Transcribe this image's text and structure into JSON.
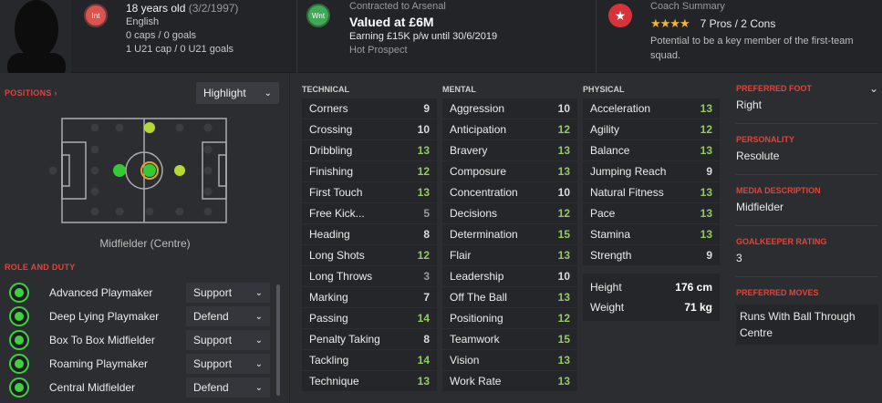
{
  "header": {
    "age": "18 years old",
    "dob": "(3/2/1997)",
    "nationality": "English",
    "caps": "0 caps / 0 goals",
    "u21": "1 U21 cap / 0 U21 goals",
    "badge_int": "Int",
    "contract_label": "Contracted to Arsenal",
    "value": "Valued at £6M",
    "earning": "Earning £15K p/w until 30/6/2019",
    "status": "Hot Prospect",
    "badge_wnt": "Wnt",
    "coach_title": "Coach Summary",
    "stars": "★★★★",
    "pros_cons": "7 Pros / 2 Cons",
    "potential": "Potential to be a key member of the first-team squad."
  },
  "positions": {
    "title": "POSITIONS",
    "filter": "Highlight",
    "position_name": "Midfielder (Centre)"
  },
  "roles": {
    "title": "ROLE AND DUTY",
    "items": [
      {
        "name": "Advanced Playmaker",
        "duty": "Support"
      },
      {
        "name": "Deep Lying Playmaker",
        "duty": "Defend"
      },
      {
        "name": "Box To Box Midfielder",
        "duty": "Support"
      },
      {
        "name": "Roaming Playmaker",
        "duty": "Support"
      },
      {
        "name": "Central Midfielder",
        "duty": "Defend"
      }
    ]
  },
  "technical": {
    "title": "TECHNICAL",
    "rows": [
      {
        "name": "Corners",
        "value": "9"
      },
      {
        "name": "Crossing",
        "value": "10"
      },
      {
        "name": "Dribbling",
        "value": "13"
      },
      {
        "name": "Finishing",
        "value": "12"
      },
      {
        "name": "First Touch",
        "value": "13"
      },
      {
        "name": "Free Kick...",
        "value": "5"
      },
      {
        "name": "Heading",
        "value": "8"
      },
      {
        "name": "Long Shots",
        "value": "12"
      },
      {
        "name": "Long Throws",
        "value": "3"
      },
      {
        "name": "Marking",
        "value": "7"
      },
      {
        "name": "Passing",
        "value": "14"
      },
      {
        "name": "Penalty Taking",
        "value": "8"
      },
      {
        "name": "Tackling",
        "value": "14"
      },
      {
        "name": "Technique",
        "value": "13"
      }
    ]
  },
  "mental": {
    "title": "MENTAL",
    "rows": [
      {
        "name": "Aggression",
        "value": "10"
      },
      {
        "name": "Anticipation",
        "value": "12"
      },
      {
        "name": "Bravery",
        "value": "13"
      },
      {
        "name": "Composure",
        "value": "13"
      },
      {
        "name": "Concentration",
        "value": "10"
      },
      {
        "name": "Decisions",
        "value": "12"
      },
      {
        "name": "Determination",
        "value": "15"
      },
      {
        "name": "Flair",
        "value": "13"
      },
      {
        "name": "Leadership",
        "value": "10"
      },
      {
        "name": "Off The Ball",
        "value": "13"
      },
      {
        "name": "Positioning",
        "value": "12"
      },
      {
        "name": "Teamwork",
        "value": "15"
      },
      {
        "name": "Vision",
        "value": "13"
      },
      {
        "name": "Work Rate",
        "value": "13"
      }
    ]
  },
  "physical": {
    "title": "PHYSICAL",
    "rows": [
      {
        "name": "Acceleration",
        "value": "13"
      },
      {
        "name": "Agility",
        "value": "12"
      },
      {
        "name": "Balance",
        "value": "13"
      },
      {
        "name": "Jumping Reach",
        "value": "9"
      },
      {
        "name": "Natural Fitness",
        "value": "13"
      },
      {
        "name": "Pace",
        "value": "13"
      },
      {
        "name": "Stamina",
        "value": "13"
      },
      {
        "name": "Strength",
        "value": "9"
      }
    ],
    "height_label": "Height",
    "height": "176 cm",
    "weight_label": "Weight",
    "weight": "71 kg"
  },
  "info": {
    "foot_label": "PREFERRED FOOT",
    "foot": "Right",
    "personality_label": "PERSONALITY",
    "personality": "Resolute",
    "media_label": "MEDIA DESCRIPTION",
    "media": "Midfielder",
    "gk_label": "GOALKEEPER RATING",
    "gk": "3",
    "moves_label": "PREFERRED MOVES",
    "moves": "Runs With Ball Through Centre"
  },
  "colors": {
    "accent": "#e0453a",
    "green": "#8fcf5a",
    "role_green": "#3fd13f"
  }
}
